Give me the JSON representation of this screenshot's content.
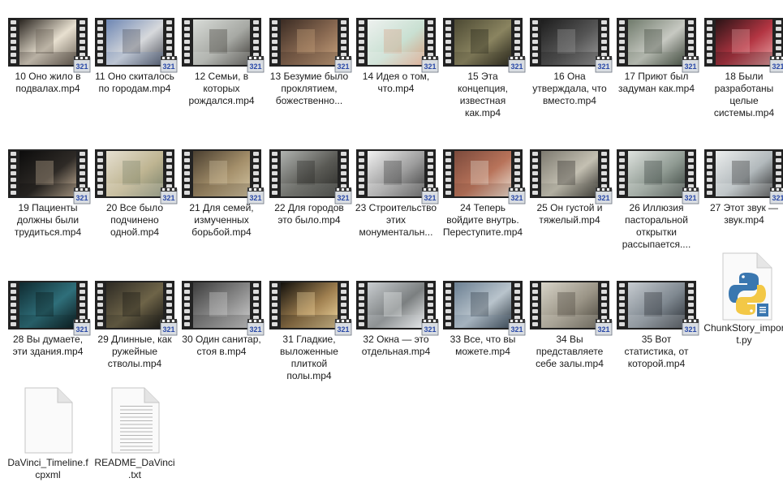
{
  "files": [
    {
      "name": "10 Оно жило в подвалах.mp4",
      "kind": "video",
      "scene": [
        "#2a2520",
        "#e8e0d0",
        "#6b6257"
      ]
    },
    {
      "name": "11 Оно скиталось по городам.mp4",
      "kind": "video",
      "scene": [
        "#6d86b3",
        "#d7d9dc",
        "#4b4e58"
      ]
    },
    {
      "name": "12 Семьи, в которых рождался.mp4",
      "kind": "video",
      "scene": [
        "#d9dcd8",
        "#a7a9a4",
        "#3e3b37"
      ]
    },
    {
      "name": "13 Безумие было проклятием, божественно...",
      "kind": "video",
      "scene": [
        "#3a2b23",
        "#8a6a52",
        "#c8a27c"
      ]
    },
    {
      "name": "14 Идея о том, что.mp4",
      "kind": "video",
      "scene": [
        "#eef1ef",
        "#c9e0d2",
        "#d69f80"
      ]
    },
    {
      "name": "15 Эта концепция, известная как.mp4",
      "kind": "video",
      "scene": [
        "#4c4933",
        "#8a8460",
        "#232117"
      ]
    },
    {
      "name": "16 Она утверждала, что вместо.mp4",
      "kind": "video",
      "scene": [
        "#1d1d1d",
        "#555555",
        "#9a9a9a"
      ]
    },
    {
      "name": "17 Приют был задуман как.mp4",
      "kind": "video",
      "scene": [
        "#6f7a6b",
        "#c7c9c2",
        "#3c4439"
      ]
    },
    {
      "name": "18 Были разработаны целые системы.mp4",
      "kind": "video",
      "scene": [
        "#2a1416",
        "#b33542",
        "#e9a3a5"
      ]
    },
    {
      "name": "19 Пациенты должны были трудиться.mp4",
      "kind": "video",
      "scene": [
        "#0c0c0c",
        "#2e2a26",
        "#c9b49a"
      ]
    },
    {
      "name": "20 Все было подчинено одной.mp4",
      "kind": "video",
      "scene": [
        "#e6e0d1",
        "#bfb592",
        "#77806b"
      ]
    },
    {
      "name": "21 Для семей, измученных борьбой.mp4",
      "kind": "video",
      "scene": [
        "#4a3f30",
        "#a48f6a",
        "#d2c4a2"
      ]
    },
    {
      "name": "22 Для городов это было.mp4",
      "kind": "video",
      "scene": [
        "#b0b3b0",
        "#5a5a55",
        "#2b2b28"
      ]
    },
    {
      "name": "23 Строительство этих монументальн...",
      "kind": "video",
      "scene": [
        "#f2f2f2",
        "#9c9c9c",
        "#3a3a3a"
      ]
    },
    {
      "name": "24 Теперь войдите внутрь. Переступите.mp4",
      "kind": "video",
      "scene": [
        "#7b4a3c",
        "#b8735a",
        "#e9e2d6"
      ]
    },
    {
      "name": "25 Он густой и тяжелый.mp4",
      "kind": "video",
      "scene": [
        "#7d7a70",
        "#c4c0b2",
        "#2e2c28"
      ]
    },
    {
      "name": "26 Иллюзия пасторальной открытки рассыпается....",
      "kind": "video",
      "scene": [
        "#dfe3df",
        "#8f9a92",
        "#37403b"
      ]
    },
    {
      "name": "27 Этот звук — звук.mp4",
      "kind": "video",
      "scene": [
        "#eceeee",
        "#b2b9bc",
        "#2e2e2e"
      ]
    },
    {
      "name": "28 Вы думаете, эти здания.mp4",
      "kind": "video",
      "scene": [
        "#0f2a30",
        "#2f6f7a",
        "#0a1618"
      ]
    },
    {
      "name": "29 Длинные, как ружейные стволы.mp4",
      "kind": "video",
      "scene": [
        "#2d2a24",
        "#6e6448",
        "#151412"
      ]
    },
    {
      "name": "30 Один санитар, стоя в.mp4",
      "kind": "video",
      "scene": [
        "#3c3c3c",
        "#8c8c8c",
        "#d0d0d0"
      ]
    },
    {
      "name": "31 Гладкие, выложенные плиткой полы.mp4",
      "kind": "video",
      "scene": [
        "#12100c",
        "#a08050",
        "#f0d8a0"
      ]
    },
    {
      "name": "32 Окна — это отдельная.mp4",
      "kind": "video",
      "scene": [
        "#c9cdd0",
        "#7b7f80",
        "#eef0f1"
      ]
    },
    {
      "name": "33 Все, что вы можете.mp4",
      "kind": "video",
      "scene": [
        "#6b7f92",
        "#b9c4cc",
        "#2e3a44"
      ]
    },
    {
      "name": "34 Вы представляете себе залы.mp4",
      "kind": "video",
      "scene": [
        "#d8d4c8",
        "#9a9486",
        "#4a463c"
      ]
    },
    {
      "name": "35 Вот статистика, от которой.mp4",
      "kind": "video",
      "scene": [
        "#c7ccd1",
        "#7f8890",
        "#2a2f35"
      ]
    },
    {
      "name": "ChunkStory_import.py",
      "kind": "python"
    },
    {
      "name": "DaVinci_Timeline.fcpxml",
      "kind": "doc"
    },
    {
      "name": "README_DaVinci.txt",
      "kind": "txt"
    }
  ],
  "colors": {
    "film_strip": "#222222",
    "film_hole": "#dcdcdc",
    "badge_bg": "#d9dde2",
    "badge_text": "#2b4aa8",
    "python_blue": "#3a77b0",
    "python_yellow": "#f3c846",
    "label_text": "#1b1b1b"
  },
  "badge_text": "321"
}
